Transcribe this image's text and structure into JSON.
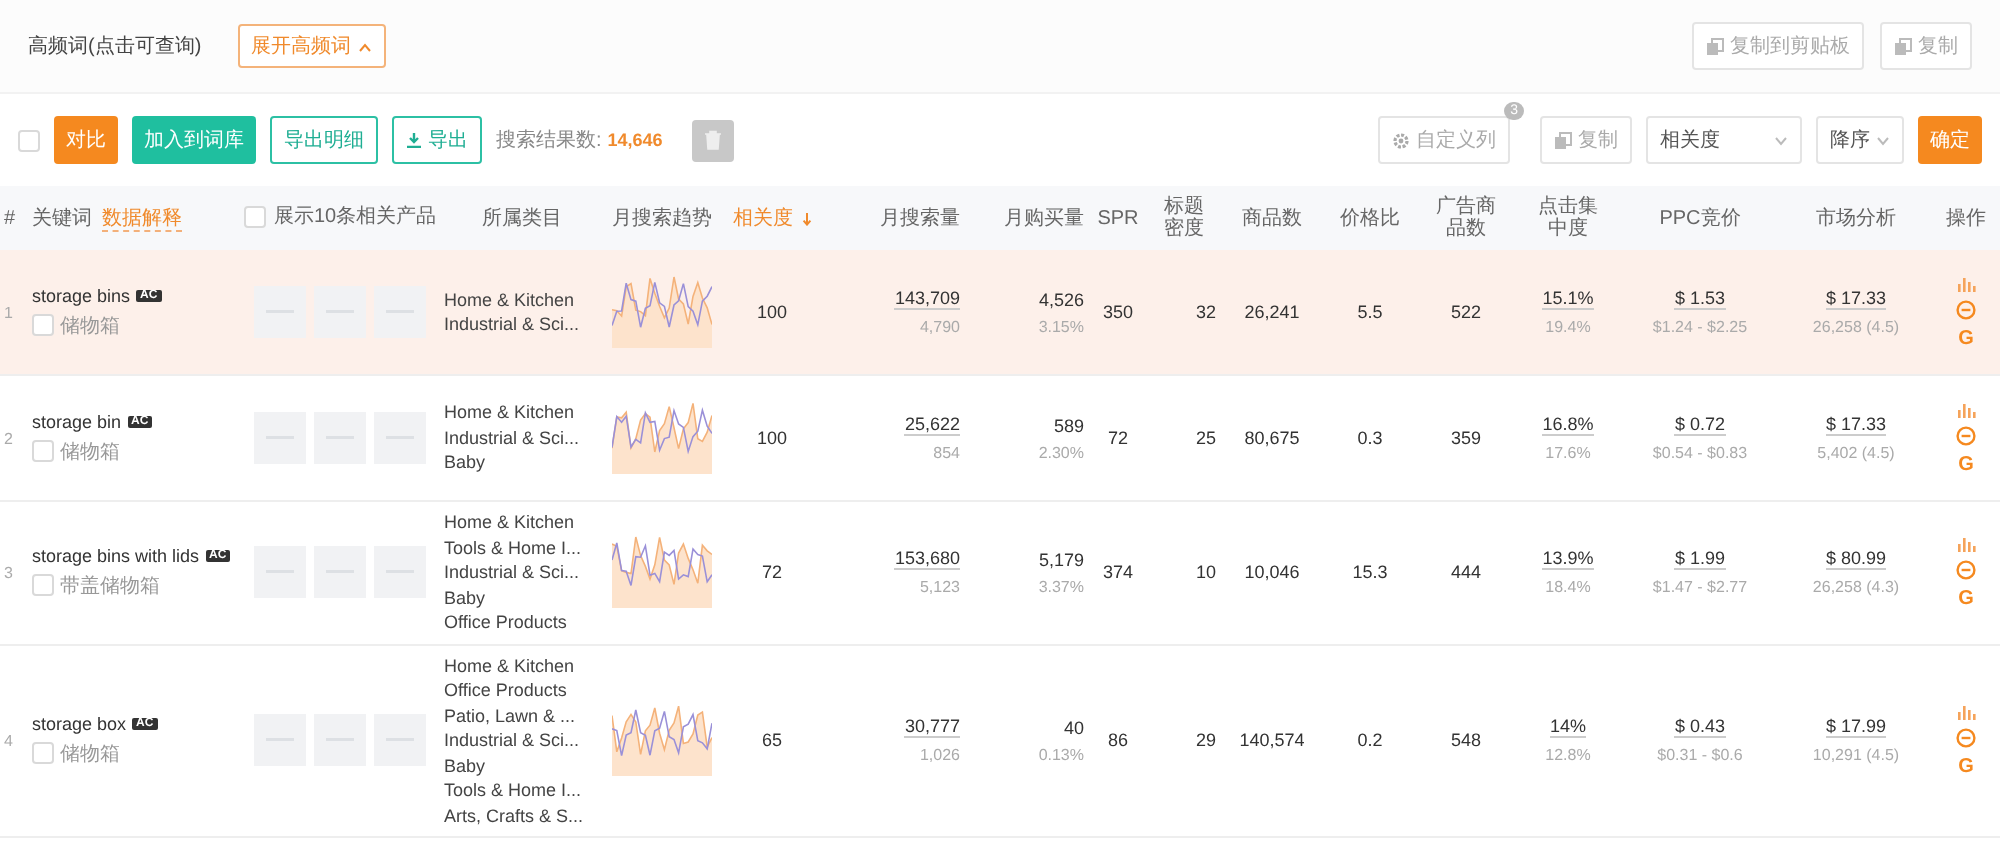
{
  "top_bar": {
    "title": "高频词(点击可查询)",
    "expand_button": "展开高频词",
    "copy_clipboard_button": "复制到剪贴板",
    "copy_button": "复制"
  },
  "toolbar": {
    "select_all": {
      "checked": false
    },
    "compare_button": "对比",
    "add_button": "加入到词库",
    "export_detail_button": "导出明细",
    "export_button": "导出",
    "result_label": "搜索结果数:",
    "result_count": "14,646",
    "custom_columns_button": "自定义列",
    "custom_columns_badge": "3",
    "copy_button": "复制",
    "sort_field": "相关度",
    "sort_order": "降序",
    "confirm_button": "确定"
  },
  "table": {
    "columns": [
      {
        "label": "#",
        "sorted": false
      },
      {
        "label": "关键词",
        "link": "数据解释",
        "sorted": false
      },
      {
        "label": "展示10条相关产品",
        "checked": false,
        "sorted": false
      },
      {
        "label": "所属类目",
        "sorted": false
      },
      {
        "label": "月搜索趋势",
        "sorted": false
      },
      {
        "label": "相关度",
        "sorted": true
      },
      {
        "label": "月搜索量",
        "sorted": false
      },
      {
        "label": "月购买量",
        "sorted": false
      },
      {
        "label": "SPR",
        "sorted": false
      },
      {
        "label": "标题密度",
        "sorted": false
      },
      {
        "label": "商品数",
        "sorted": false
      },
      {
        "label": "价格比",
        "sorted": false
      },
      {
        "label": "广告商品数",
        "sorted": false
      },
      {
        "label": "点击集中度",
        "sorted": false
      },
      {
        "label": "PPC竞价",
        "sorted": false
      },
      {
        "label": "市场分析",
        "sorted": false
      },
      {
        "label": "操作",
        "sorted": false
      }
    ],
    "rows": [
      {
        "index": "1",
        "keyword": "storage bins",
        "badge": "AC",
        "translation": "储物箱",
        "checked": false,
        "highlighted": true,
        "images": [
          {
            "kind": "placeholder"
          },
          {
            "kind": "placeholder"
          },
          {
            "kind": "placeholder"
          }
        ],
        "categories": [
          "Home & Kitchen",
          "Industrial & Sci..."
        ],
        "relevance": "100",
        "search": "143,709",
        "search_sub": "4,790",
        "purchase": "4,526",
        "purchase_rate": "3.15%",
        "spr": "350",
        "title_density": "32",
        "products": "26,241",
        "price_ratio": "5.5",
        "ad_products": "522",
        "click_conc": "15.1%",
        "click_conc_sub": "19.4%",
        "ppc": "$ 1.53",
        "ppc_range": "$1.24 - $2.25",
        "market": "$ 17.33",
        "market_sub": "26,258 (4.5)",
        "actions": [
          {
            "kind": "chart"
          },
          {
            "kind": "circle"
          },
          {
            "kind": "letter",
            "label": "G"
          }
        ]
      },
      {
        "index": "2",
        "keyword": "storage bin",
        "badge": "AC",
        "translation": "储物箱",
        "checked": false,
        "highlighted": false,
        "images": [
          {
            "kind": "placeholder"
          },
          {
            "kind": "placeholder"
          },
          {
            "kind": "placeholder"
          }
        ],
        "categories": [
          "Home & Kitchen",
          "Industrial & Sci...",
          "Baby"
        ],
        "relevance": "100",
        "search": "25,622",
        "search_sub": "854",
        "purchase": "589",
        "purchase_rate": "2.30%",
        "spr": "72",
        "title_density": "25",
        "products": "80,675",
        "price_ratio": "0.3",
        "ad_products": "359",
        "click_conc": "16.8%",
        "click_conc_sub": "17.6%",
        "ppc": "$ 0.72",
        "ppc_range": "$0.54 - $0.83",
        "market": "$ 17.33",
        "market_sub": "5,402 (4.5)",
        "actions": [
          {
            "kind": "chart"
          },
          {
            "kind": "circle"
          },
          {
            "kind": "letter",
            "label": "G"
          }
        ]
      },
      {
        "index": "3",
        "keyword": "storage bins with lids",
        "badge": "AC",
        "translation": "带盖储物箱",
        "checked": false,
        "highlighted": false,
        "images": [
          {
            "kind": "placeholder"
          },
          {
            "kind": "placeholder"
          },
          {
            "kind": "placeholder"
          }
        ],
        "categories": [
          "Home & Kitchen",
          "Tools & Home I...",
          "Industrial & Sci...",
          "Baby",
          "Office Products"
        ],
        "relevance": "72",
        "search": "153,680",
        "search_sub": "5,123",
        "purchase": "5,179",
        "purchase_rate": "3.37%",
        "spr": "374",
        "title_density": "10",
        "products": "10,046",
        "price_ratio": "15.3",
        "ad_products": "444",
        "click_conc": "13.9%",
        "click_conc_sub": "18.4%",
        "ppc": "$ 1.99",
        "ppc_range": "$1.47 - $2.77",
        "market": "$ 80.99",
        "market_sub": "26,258 (4.3)",
        "actions": [
          {
            "kind": "chart"
          },
          {
            "kind": "circle"
          },
          {
            "kind": "letter",
            "label": "G"
          }
        ]
      },
      {
        "index": "4",
        "keyword": "storage box",
        "badge": "AC",
        "translation": "储物箱",
        "checked": false,
        "highlighted": false,
        "images": [
          {
            "kind": "placeholder"
          },
          {
            "kind": "placeholder"
          },
          {
            "kind": "placeholder"
          }
        ],
        "categories": [
          "Home & Kitchen",
          "Office Products",
          "Patio, Lawn & ...",
          "Industrial & Sci...",
          "Baby",
          "Tools & Home I...",
          "Arts, Crafts & S..."
        ],
        "relevance": "65",
        "search": "30,777",
        "search_sub": "1,026",
        "purchase": "40",
        "purchase_rate": "0.13%",
        "spr": "86",
        "title_density": "29",
        "products": "140,574",
        "price_ratio": "0.2",
        "ad_products": "548",
        "click_conc": "14%",
        "click_conc_sub": "12.8%",
        "ppc": "$ 0.43",
        "ppc_range": "$0.31 - $0.6",
        "market": "$ 17.99",
        "market_sub": "10,291 (4.5)",
        "actions": [
          {
            "kind": "chart"
          },
          {
            "kind": "circle"
          },
          {
            "kind": "letter",
            "label": "G"
          }
        ]
      }
    ]
  }
}
